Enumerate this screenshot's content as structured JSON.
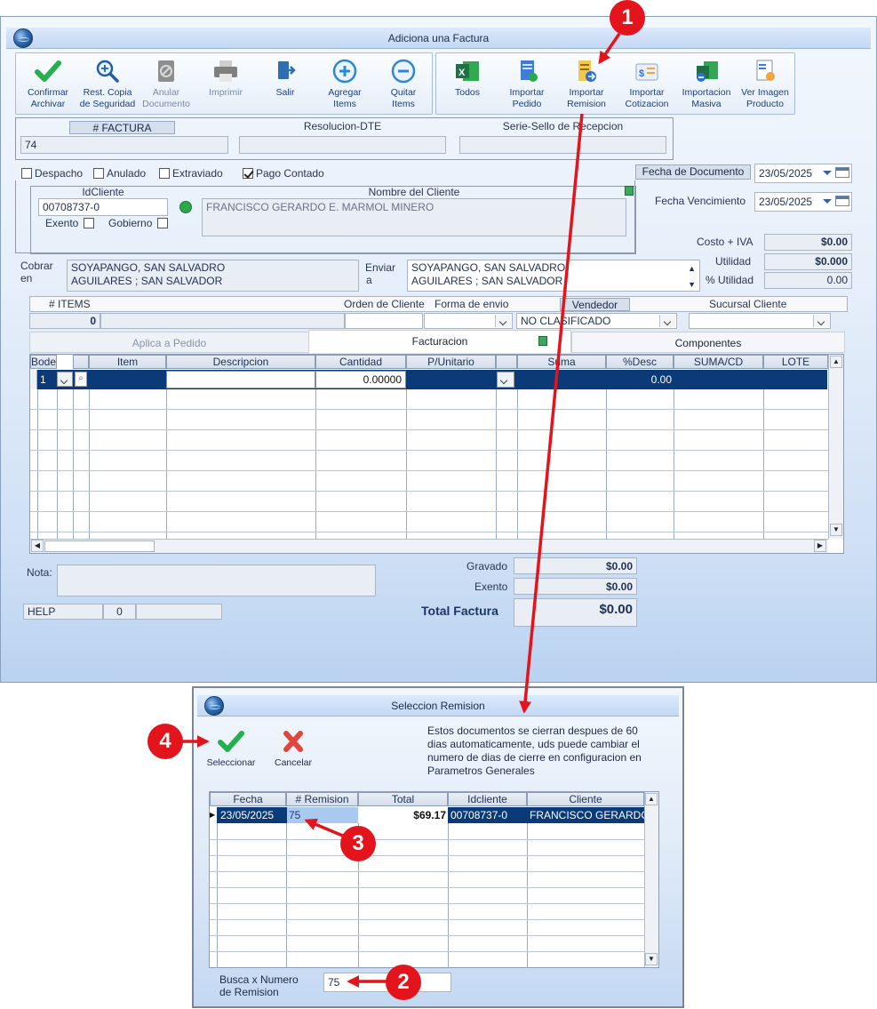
{
  "main_window": {
    "title": "Adiciona una Factura",
    "toolbar_left": [
      {
        "l1": "Confirmar",
        "l2": "Archivar",
        "icon": "check-icon"
      },
      {
        "l1": "Rest. Copia",
        "l2": "de Seguridad",
        "icon": "magnifier-icon"
      },
      {
        "l1": "Anular",
        "l2": "Documento",
        "icon": "void-document-icon"
      },
      {
        "l1": "Imprimir",
        "l2": "",
        "icon": "printer-icon"
      },
      {
        "l1": "Salir",
        "l2": "",
        "icon": "exit-icon"
      },
      {
        "l1": "Agregar",
        "l2": "Items",
        "icon": "plus-circle-icon"
      },
      {
        "l1": "Quitar",
        "l2": "Items",
        "icon": "minus-circle-icon"
      }
    ],
    "toolbar_right": [
      {
        "l1": "Todos",
        "l2": "",
        "icon": "excel-icon"
      },
      {
        "l1": "Importar",
        "l2": "Pedido",
        "icon": "order-import-icon"
      },
      {
        "l1": "Importar",
        "l2": "Remision",
        "icon": "remision-import-icon"
      },
      {
        "l1": "Importar",
        "l2": "Cotizacion",
        "icon": "quote-import-icon"
      },
      {
        "l1": "Importacion",
        "l2": "Masiva",
        "icon": "excel-mass-import-icon"
      },
      {
        "l1": "Ver Imagen",
        "l2": "Producto",
        "icon": "product-image-icon"
      }
    ],
    "factura": {
      "num_label": "# FACTURA",
      "num_value": "74",
      "resolucion_label": "Resolucion-DTE",
      "resolucion_value": "",
      "serie_label": "Serie-Sello de Recepcion",
      "serie_value": ""
    },
    "flags": {
      "despacho": "Despacho",
      "anulado": "Anulado",
      "extraviado": "Extraviado",
      "pago_contado": "Pago Contado"
    },
    "fecha_documento_label": "Fecha de  Documento",
    "fecha_documento_value": "23/05/2025",
    "fecha_vencimiento_label": "Fecha Vencimiento",
    "fecha_vencimiento_value": "23/05/2025",
    "cliente": {
      "id_label": "IdCliente",
      "id_value": "00708737-0",
      "nombre_label": "Nombre del Cliente",
      "nombre_value": "FRANCISCO GERARDO E. MARMOL MINERO",
      "exento_label": "Exento",
      "gobierno_label": "Gobierno"
    },
    "totales_top": {
      "costo_label": "Costo + IVA",
      "costo_value": "$0.00",
      "utilidad_label": "Utilidad",
      "utilidad_value": "$0.000",
      "pct_utilidad_label": "% Utilidad",
      "pct_utilidad_value": "0.00"
    },
    "cobrar_label_1": "Cobrar",
    "cobrar_label_2": "en",
    "cobrar_line1": "SOYAPANGO, SAN SALVADRO",
    "cobrar_line2": "AGUILARES ; SAN SALVADOR",
    "enviar_label_1": "Enviar",
    "enviar_label_2": "a",
    "enviar_line1": "SOYAPANGO, SAN SALVADRO",
    "enviar_line2": "AGUILARES ; SAN SALVADOR",
    "info_row": {
      "items_label": "# ITEMS",
      "items_value": "0",
      "orden_label": "Orden de Cliente",
      "envio_label": "Forma de envio",
      "vendedor_label": "Vendedor",
      "vendedor_value": "NO CLASIFICADO",
      "sucursal_label": "Sucursal Cliente"
    },
    "tabs": [
      "Aplica a Pedido",
      "Facturacion",
      "Componentes"
    ],
    "grid": {
      "headers": [
        "Bodega",
        "",
        "Item",
        "Descripcion",
        "Cantidad",
        "P/Unitario",
        "",
        "Suma",
        "%Desc",
        "SUMA/CD",
        "LOTE"
      ],
      "row1": {
        "bodega": "1",
        "cantidad": "0.00000",
        "desc": "0.00"
      }
    },
    "nota_label": "Nota:",
    "help": {
      "label": "HELP",
      "value": "0"
    },
    "totales_bottom": {
      "gravado_label": "Gravado",
      "gravado_value": "$0.00",
      "exento_label": "Exento",
      "exento_value": "$0.00",
      "total_label": "Total Factura",
      "total_value": "$0.00"
    }
  },
  "dialog": {
    "title": "Seleccion Remision",
    "seleccionar_label": "Seleccionar",
    "cancelar_label": "Cancelar",
    "info": [
      "Estos documentos se cierran despues de 60",
      "dias automaticamente, uds puede cambiar el",
      "numero de dias de cierre en configuracion en",
      "Parametros Generales"
    ],
    "grid_headers": [
      "Fecha",
      "# Remision",
      "Total",
      "Idcliente",
      "Cliente"
    ],
    "row": {
      "fecha": "23/05/2025",
      "remision": "75",
      "total": "$69.17",
      "idcliente": "00708737-0",
      "cliente": "FRANCISCO GERARDO"
    },
    "busca_label_1": "Busca x Numero",
    "busca_label_2": "de Remision",
    "busca_value": "75"
  },
  "annotations": [
    "1",
    "2",
    "3",
    "4"
  ],
  "colors": {
    "annotation_red": "#e3141b",
    "selection_blue": "#0a3a78",
    "link_blue": "#1d3f7a"
  }
}
